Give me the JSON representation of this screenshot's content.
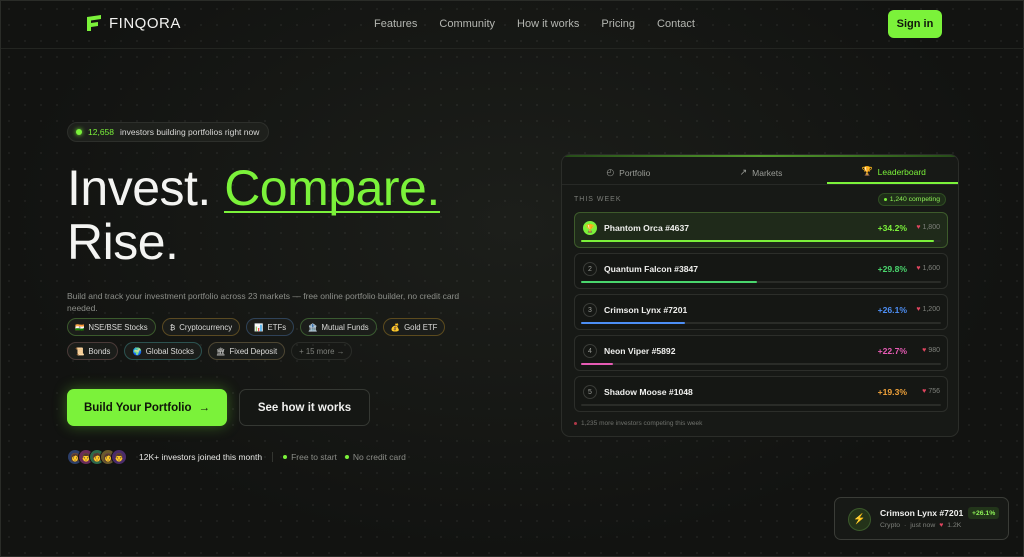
{
  "brand": {
    "name": "FINQORA",
    "accent": "#7bf23a"
  },
  "nav": {
    "links": [
      "Features",
      "Community",
      "How it works",
      "Pricing",
      "Contact"
    ],
    "signin_label": "Sign in"
  },
  "hero": {
    "pill_count": "12,658",
    "pill_text": "investors building portfolios right now",
    "headline_1": "Invest.",
    "headline_accent": "Compare.",
    "headline_2": "Rise.",
    "subtitle": "Build and track your investment portfolio across 23 markets — free online portfolio builder, no credit card needed.",
    "chips": [
      {
        "icon": "🇮🇳",
        "label": "NSE/BSE Stocks"
      },
      {
        "icon": "₿",
        "label": "Cryptocurrency"
      },
      {
        "icon": "📊",
        "label": "ETFs"
      },
      {
        "icon": "🏦",
        "label": "Mutual Funds"
      },
      {
        "icon": "💰",
        "label": "Gold ETF"
      },
      {
        "icon": "📜",
        "label": "Bonds"
      },
      {
        "icon": "🌍",
        "label": "Global Stocks"
      },
      {
        "icon": "🏛",
        "label": "Fixed Deposit"
      },
      {
        "icon": "",
        "label": "+ 15 more →"
      }
    ],
    "primary_button": "Build Your Portfolio",
    "primary_arrow": "→",
    "secondary_button": "See how it works",
    "avatars": [
      "👩",
      "👨",
      "🧑",
      "👩",
      "👨"
    ],
    "social_text": "12K+ investors joined this month",
    "perks": [
      "Free to start",
      "No credit card"
    ]
  },
  "card": {
    "tabs": [
      {
        "icon": "◴",
        "label": "Portfolio"
      },
      {
        "icon": "↗",
        "label": "Markets"
      },
      {
        "icon": "🏆",
        "label": "Leaderboard"
      }
    ],
    "week_label": "THIS WEEK",
    "competing": "1,240 competing",
    "rows": [
      {
        "rank": "🏆",
        "name": "Phantom Orca #4637",
        "change": "+34.2%",
        "likes": "1,800",
        "progress": 0.98,
        "color": "#7bf23a"
      },
      {
        "rank": "2",
        "name": "Quantum Falcon #3847",
        "change": "+29.8%",
        "likes": "1,600",
        "progress": 0.49,
        "color": "#4ad66d"
      },
      {
        "rank": "3",
        "name": "Crimson Lynx #7201",
        "change": "+26.1%",
        "likes": "1,200",
        "progress": 0.29,
        "color": "#4d8ff5"
      },
      {
        "rank": "4",
        "name": "Neon Viper #5892",
        "change": "+22.7%",
        "likes": "980",
        "progress": 0.09,
        "color": "#e65bb4"
      },
      {
        "rank": "5",
        "name": "Shadow Moose #1048",
        "change": "+19.3%",
        "likes": "756",
        "progress": 0.0,
        "color": "#f0a23a"
      }
    ],
    "footnote": "1,235 more investors competing this week"
  },
  "toast": {
    "icon": "⚡",
    "name": "Crimson Lynx #7201",
    "badge": "+26.1%",
    "category": "Crypto",
    "time": "just now",
    "likes": "1.2K"
  }
}
